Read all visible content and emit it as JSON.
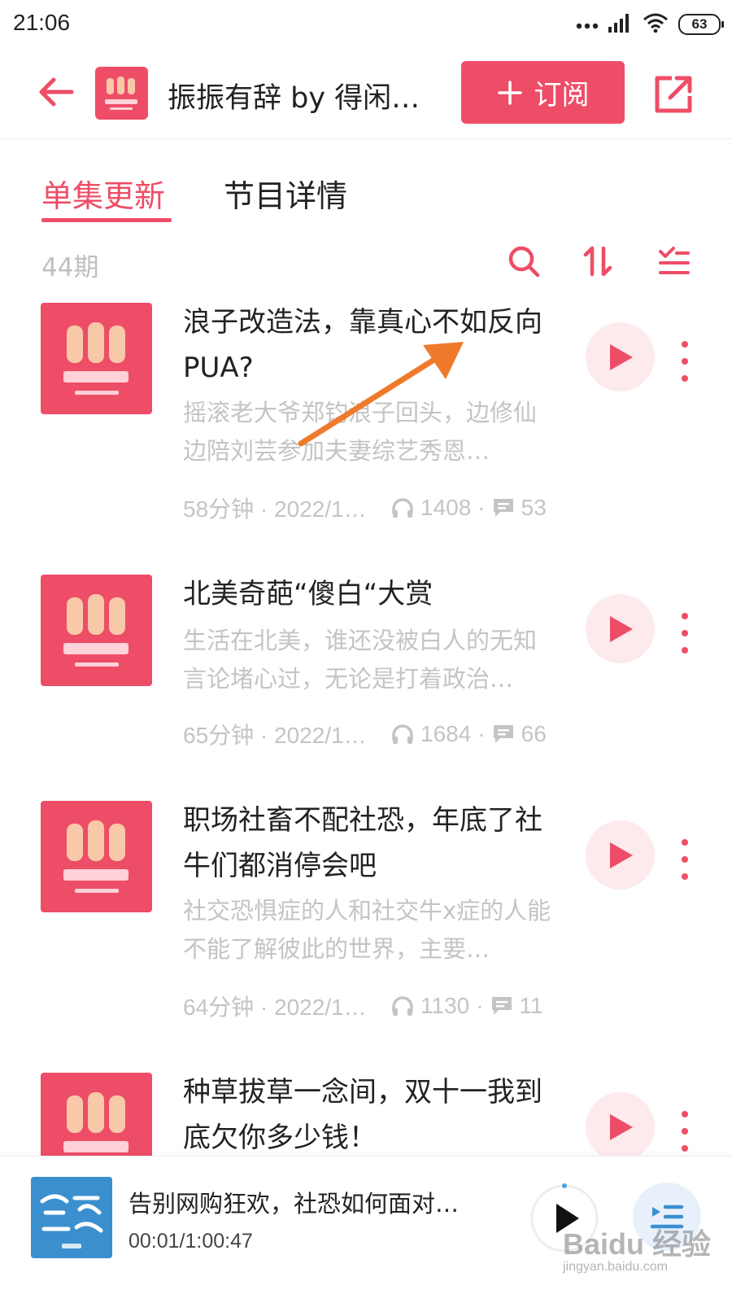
{
  "status_bar": {
    "time": "21:06",
    "battery": "63"
  },
  "header": {
    "title": "振振有辞 by 得闲…",
    "subscribe_label": "订阅"
  },
  "tabs": [
    {
      "label": "单集更新",
      "active": true
    },
    {
      "label": "节目详情",
      "active": false
    }
  ],
  "toolbar": {
    "episode_count": "44期"
  },
  "episodes": [
    {
      "title": "浪子改造法，靠真心不如反向PUA?",
      "description": "摇滚老大爷郑钧浪子回头，边修仙边陪刘芸参加夫妻综艺秀恩…",
      "duration_date": "58分钟 · 2022/1…",
      "plays": "1408",
      "comments": "53"
    },
    {
      "title": "北美奇葩“傻白“大赏",
      "description": "生活在北美，谁还没被白人的无知言论堵心过，无论是打着政治…",
      "duration_date": "65分钟 · 2022/1…",
      "plays": "1684",
      "comments": "66"
    },
    {
      "title": "职场社畜不配社恐，年底了社牛们都消停会吧",
      "description": "社交恐惧症的人和社交牛x症的人能不能了解彼此的世界，主要…",
      "duration_date": "64分钟 · 2022/1…",
      "plays": "1130",
      "comments": "11"
    },
    {
      "title": "种草拔草一念间，双十一我到底欠你多少钱！"
    }
  ],
  "mini_player": {
    "title": "告别网购狂欢，社恐如何面对…",
    "time": "00:01/1:00:47"
  },
  "watermark": {
    "brand": "Baidu 经验",
    "url": "jingyan.baidu.com"
  },
  "colors": {
    "accent": "#ee4d67",
    "muted_text": "#c4c4c4",
    "play_bg": "#fdeaed"
  }
}
